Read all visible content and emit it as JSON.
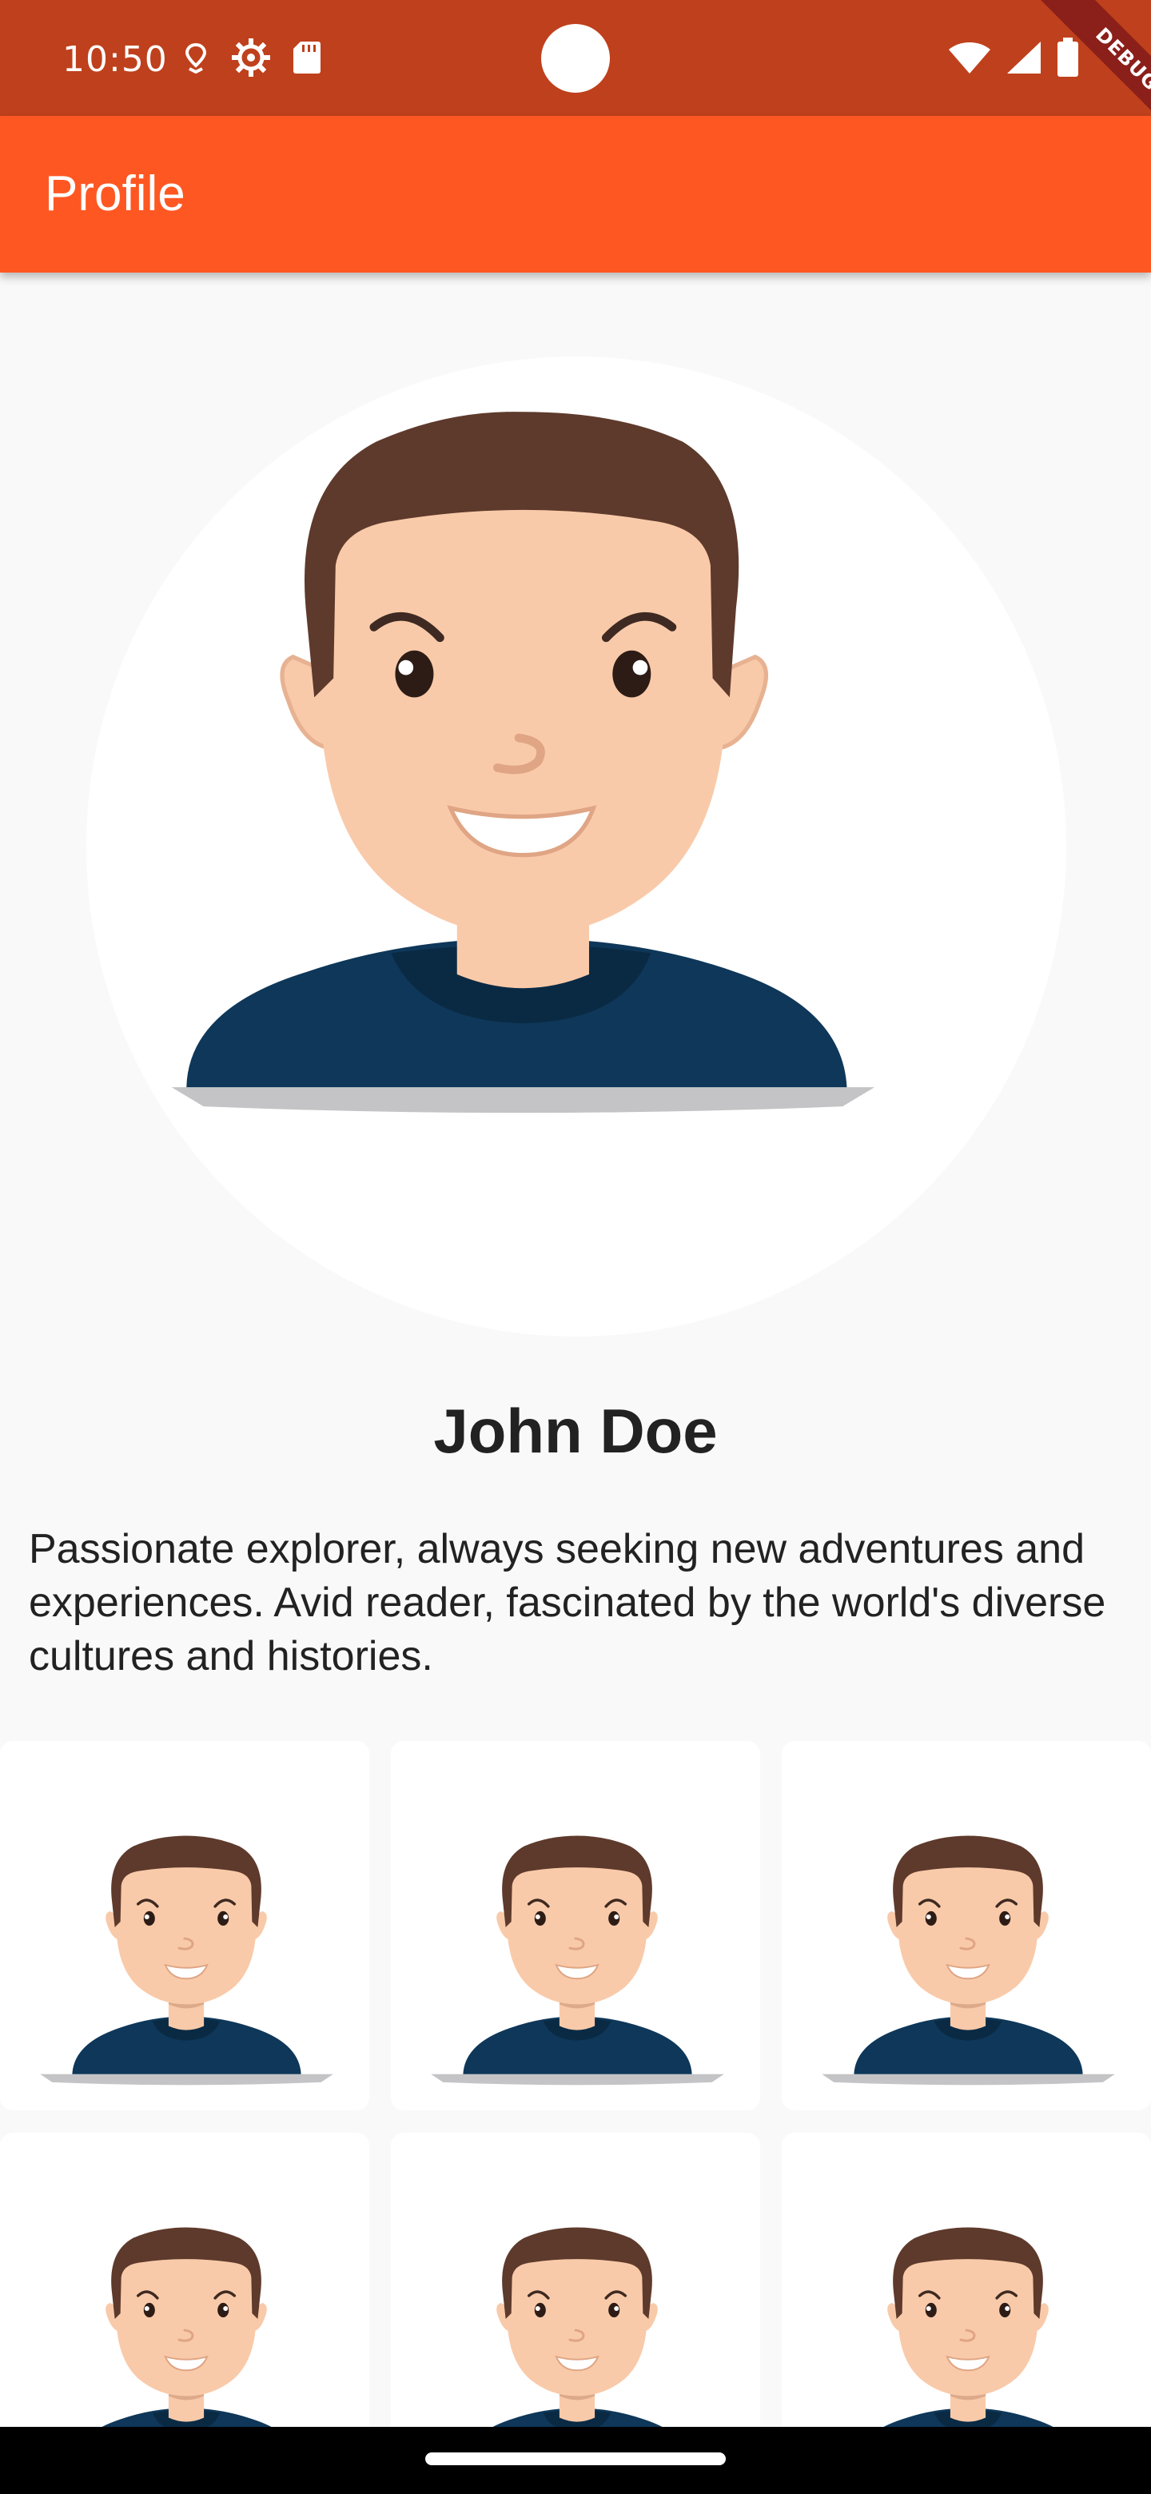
{
  "status_bar": {
    "time": "10:50",
    "left_icons": [
      "location-icon",
      "settings-icon",
      "sd-card-icon"
    ],
    "right_icons": [
      "wifi-icon",
      "signal-icon",
      "battery-icon"
    ],
    "debug_label": "DEBUG",
    "background": "#bf401c"
  },
  "app_bar": {
    "title": "Profile",
    "background": "#ff5722"
  },
  "profile": {
    "avatar_icon": "avatar-icon",
    "name": "John Doe",
    "bio": "Passionate explorer, always seeking new adventures and experiences. Avid reader, fascinated by the world's diverse cultures and histories."
  },
  "gallery": {
    "items": [
      {
        "icon": "avatar-icon"
      },
      {
        "icon": "avatar-icon"
      },
      {
        "icon": "avatar-icon"
      },
      {
        "icon": "avatar-icon"
      },
      {
        "icon": "avatar-icon"
      },
      {
        "icon": "avatar-icon"
      }
    ]
  },
  "colors": {
    "hair": "#5e3a2c",
    "skin": "#f9caa9",
    "shirt": "#0e3759",
    "collar": "#0a2a44",
    "shadow": "#c4c4c6"
  }
}
